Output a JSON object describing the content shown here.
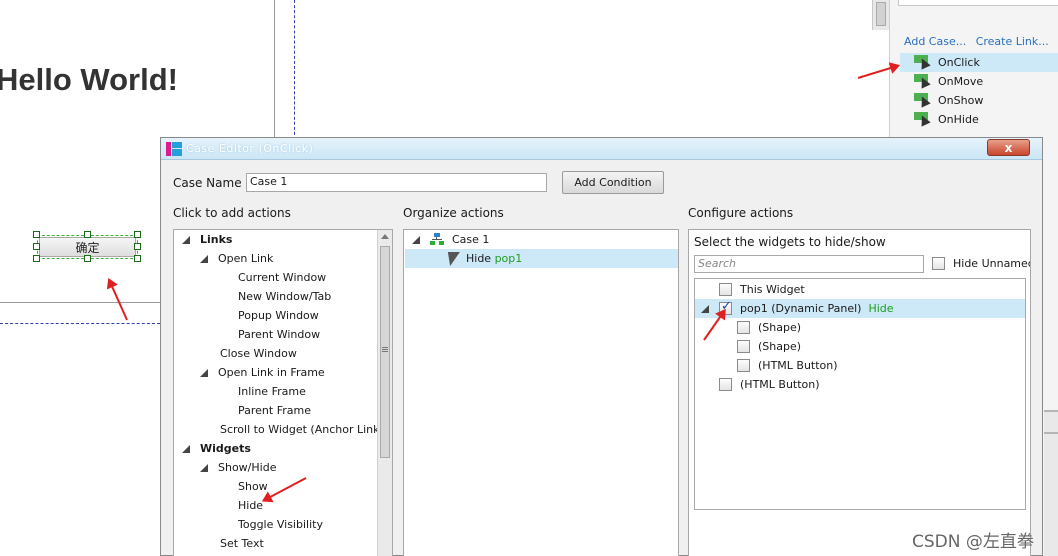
{
  "canvas": {
    "hello_text": "Hello World!",
    "button_label": "确定"
  },
  "right_panel": {
    "add_case": "Add Case...",
    "create_link": "Create Link...",
    "events": [
      {
        "label": "OnClick",
        "selected": true
      },
      {
        "label": "OnMove",
        "selected": false
      },
      {
        "label": "OnShow",
        "selected": false
      },
      {
        "label": "OnHide",
        "selected": false
      }
    ]
  },
  "dialog": {
    "title": "Case Editor (OnClick)",
    "close_label": "x",
    "case_name_label": "Case Name",
    "case_name_value": "Case 1",
    "add_condition": "Add Condition",
    "headers": {
      "click_to_add": "Click to add actions",
      "organize": "Organize actions",
      "configure": "Configure actions"
    },
    "actions_tree": [
      {
        "label": "Links",
        "level": 0,
        "bold": true,
        "expander": true
      },
      {
        "label": "Open Link",
        "level": 1,
        "bold": false,
        "expander": true
      },
      {
        "label": "Current Window",
        "level": 2,
        "bold": false,
        "expander": false
      },
      {
        "label": "New Window/Tab",
        "level": 2,
        "bold": false,
        "expander": false
      },
      {
        "label": "Popup Window",
        "level": 2,
        "bold": false,
        "expander": false
      },
      {
        "label": "Parent Window",
        "level": 2,
        "bold": false,
        "expander": false
      },
      {
        "label": "Close Window",
        "level": 1,
        "bold": false,
        "expander": false
      },
      {
        "label": "Open Link in Frame",
        "level": 1,
        "bold": false,
        "expander": true
      },
      {
        "label": "Inline Frame",
        "level": 2,
        "bold": false,
        "expander": false
      },
      {
        "label": "Parent Frame",
        "level": 2,
        "bold": false,
        "expander": false
      },
      {
        "label": "Scroll to Widget (Anchor Link)",
        "level": 1,
        "bold": false,
        "expander": false
      },
      {
        "label": "Widgets",
        "level": 0,
        "bold": true,
        "expander": true
      },
      {
        "label": "Show/Hide",
        "level": 1,
        "bold": false,
        "expander": true
      },
      {
        "label": "Show",
        "level": 2,
        "bold": false,
        "expander": false
      },
      {
        "label": "Hide",
        "level": 2,
        "bold": false,
        "expander": false
      },
      {
        "label": "Toggle Visibility",
        "level": 2,
        "bold": false,
        "expander": false
      },
      {
        "label": "Set Text",
        "level": 1,
        "bold": false,
        "expander": false
      }
    ],
    "organize": {
      "case_label": "Case 1",
      "action_verb": "Hide",
      "action_target": "pop1"
    },
    "configure": {
      "select_label": "Select the widgets to hide/show",
      "search_placeholder": "Search",
      "hide_unnamed": "Hide Unnamed",
      "widgets": [
        {
          "label": "This Widget",
          "level": 0,
          "checked": false,
          "expander": false,
          "status": ""
        },
        {
          "label": "pop1 (Dynamic Panel)",
          "level": 0,
          "checked": true,
          "expander": true,
          "status": "Hide"
        },
        {
          "label": "(Shape)",
          "level": 1,
          "checked": false,
          "expander": false,
          "status": ""
        },
        {
          "label": "(Shape)",
          "level": 1,
          "checked": false,
          "expander": false,
          "status": ""
        },
        {
          "label": "(HTML Button)",
          "level": 1,
          "checked": false,
          "expander": false,
          "status": ""
        },
        {
          "label": "(HTML Button)",
          "level": 0,
          "checked": false,
          "expander": false,
          "status": ""
        }
      ]
    }
  },
  "watermark": "CSDN @左直拳"
}
